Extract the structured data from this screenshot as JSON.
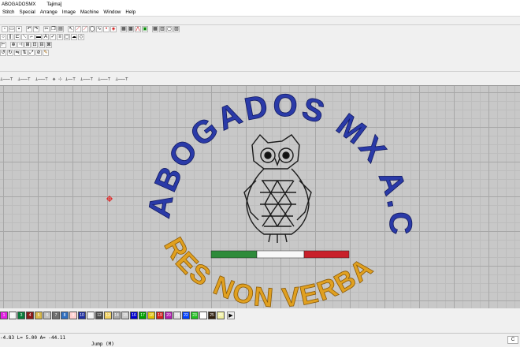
{
  "window": {
    "title": "ABOGADOSMX",
    "machine": "Tajima]"
  },
  "menu": [
    "Stitch",
    "Special",
    "Arrange",
    "Image",
    "Machine",
    "Window",
    "Help"
  ],
  "design": {
    "top_text": "ABOGADOS MX A.C.",
    "bottom_text": "RES NON VERBA",
    "top_color": "#2a3aa8",
    "bottom_color": "#e0a020",
    "flag_colors": [
      "#2e8b3a",
      "#ffffff",
      "#c8202a"
    ]
  },
  "toolbar_icons": [
    "new-icon",
    "open-icon",
    "save-icon",
    "print-icon",
    "cut-icon",
    "copy-icon",
    "paste-icon",
    "undo-icon",
    "redo-icon",
    "select-icon",
    "line-stitch-icon",
    "fill-stitch-icon",
    "satin-icon",
    "grid-icon",
    "zoom-icon"
  ],
  "palette": {
    "colors": [
      "#e020e0",
      "#f5f5f5",
      "#0a7a3a",
      "#8b1a1a",
      "#d8b84a",
      "#c0c0c0",
      "#707070",
      "#3070c0",
      "#ffd0d0",
      "#2030a0",
      "#f0f0f0",
      "#4a4a4a",
      "#f0d060",
      "#a8a8a8",
      "#c8c8c8",
      "#0000d0",
      "#00a000",
      "#e0c000",
      "#d02020",
      "#b020b0",
      "#e0e0e0",
      "#0040ff",
      "#20c020",
      "#ffffff",
      "#302010",
      "#f0f0a0"
    ],
    "labels": [
      "1",
      "2",
      "3",
      "4",
      "5",
      "6",
      "7",
      "8",
      "9",
      "10",
      "11",
      "12",
      "13",
      "14",
      "15",
      "16",
      "17",
      "18",
      "19",
      "20",
      "21",
      "22",
      "23",
      "24",
      "25",
      "26"
    ]
  },
  "status": {
    "coords": "-4.83 L=   5.00 A= -44.11",
    "mode": "Jump (M)",
    "right_cell": "C"
  }
}
